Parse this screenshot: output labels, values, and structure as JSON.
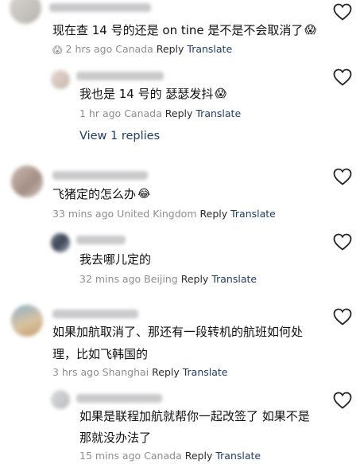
{
  "comments": [
    {
      "text": "现在查 14 号的还是 on tine 是不是不会取消了",
      "emoji": "😱",
      "time": "2 hrs ago",
      "location": "Canada",
      "reply": "Reply",
      "translate": "Translate"
    },
    {
      "text": "我也是 14 号的 瑟瑟发抖",
      "emoji": "😱",
      "time": "1 hr ago",
      "location": "Canada",
      "reply": "Reply",
      "translate": "Translate",
      "view_replies": "View 1 replies"
    },
    {
      "text": "飞猪定的怎么办",
      "emoji": "😂",
      "time": "33 mins ago",
      "location": "United Kingdom",
      "reply": "Reply",
      "translate": "Translate"
    },
    {
      "text": "我去哪儿定的",
      "time": "32 mins ago",
      "location": "Beijing",
      "reply": "Reply",
      "translate": "Translate"
    },
    {
      "text_line1": "如果加航取消了、那还有一段转机的航班如何处",
      "text_line2": "理，比如飞韩国的",
      "time": "3 hrs ago",
      "location": "Shanghai",
      "reply": "Reply",
      "translate": "Translate"
    },
    {
      "text_line1": "如果是联程加航就帮你一起改签了 如果不是",
      "text_line2": "那就没办法了",
      "time": "15 mins ago",
      "location": "Canada",
      "reply": "Reply",
      "translate": "Translate"
    }
  ],
  "icons": {
    "like": "heart-outline-icon"
  },
  "colors": {
    "link": "#1f3d66",
    "meta": "#8e8e8e"
  }
}
